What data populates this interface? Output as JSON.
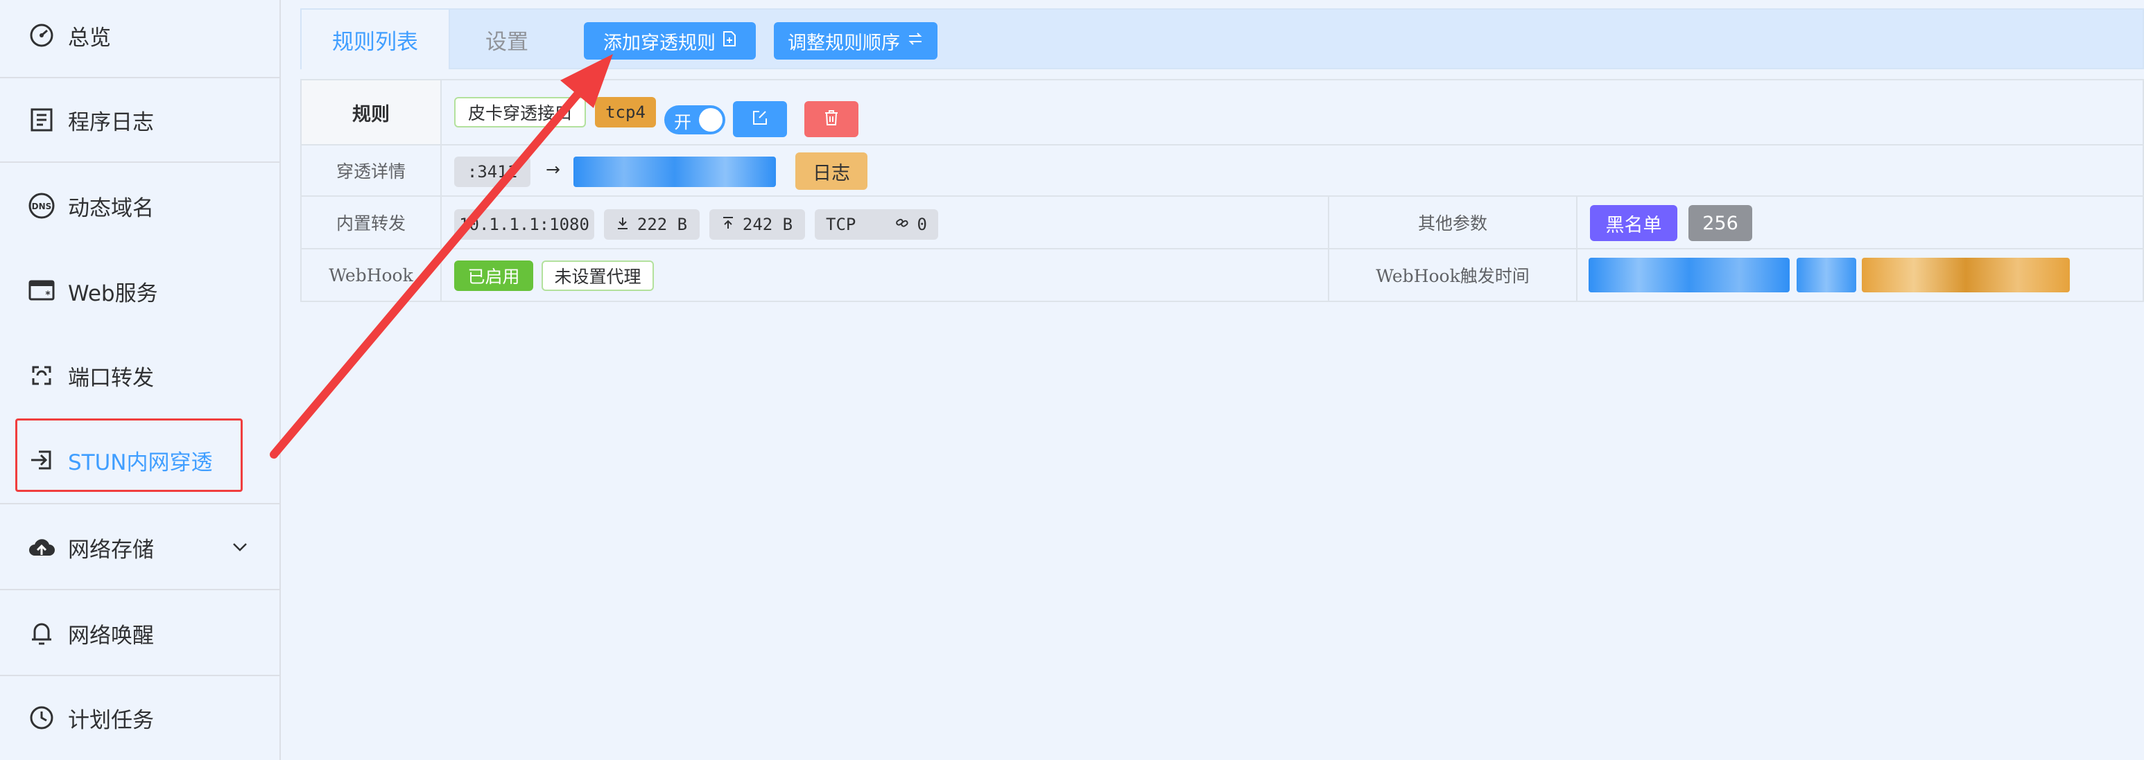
{
  "sidebar": {
    "items": [
      {
        "label": "总览",
        "icon": "dashboard-gauge-icon"
      },
      {
        "label": "程序日志",
        "icon": "log-document-icon"
      },
      {
        "label": "动态域名",
        "icon": "dns-icon"
      },
      {
        "label": "Web服务",
        "icon": "web-service-icon"
      },
      {
        "label": "端口转发",
        "icon": "port-forward-icon"
      },
      {
        "label": "STUN内网穿透",
        "icon": "stun-penetration-icon"
      },
      {
        "label": "网络存储",
        "icon": "cloud-upload-icon"
      },
      {
        "label": "网络唤醒",
        "icon": "bell-icon"
      },
      {
        "label": "计划任务",
        "icon": "clock-icon"
      }
    ],
    "active_index": 5
  },
  "tabs": [
    {
      "label": "规则列表"
    },
    {
      "label": "设置"
    }
  ],
  "toolbar": {
    "add_rule_label": "添加穿透规则",
    "reorder_label": "调整规则顺序"
  },
  "rule": {
    "label_rule": "规则",
    "name": "皮卡穿透接口",
    "protocol": "tcp4",
    "switch_label": "开",
    "label_detail": "穿透详情",
    "port": ":3411",
    "arrow": "→",
    "log_button": "日志",
    "label_forward": "内置转发",
    "forward_addr": "10.1.1.1:1080",
    "download": "222 B",
    "upload": "242 B",
    "forward_proto": "TCP",
    "connections": "0",
    "label_other": "其他参数",
    "blacklist": "黑名单",
    "count": "256",
    "label_webhook": "WebHook",
    "webhook_enabled": "已启用",
    "proxy_status": "未设置代理",
    "label_webhook_time": "WebHook触发时间"
  },
  "colors": {
    "accent": "#409eff",
    "danger": "#f56c6c",
    "warning": "#e6a23c",
    "success": "#67c23a",
    "purple": "#7262ff",
    "annotation_red": "#f03e3e"
  }
}
